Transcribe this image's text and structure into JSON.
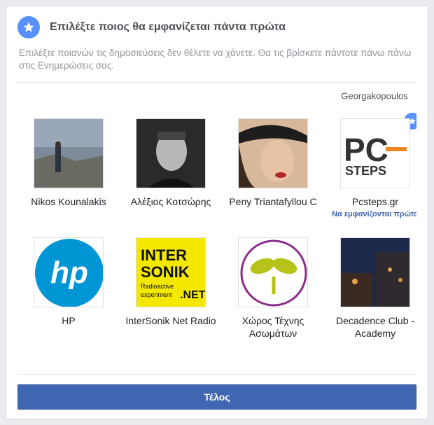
{
  "dialog": {
    "title": "Επιλέξτε ποιος θα εμφανίζεται πάντα πρώτα",
    "subtitle": "Επιλέξτε ποιανών τις δημοσιεύσεις δεν θέλετε να χάνετε. Θα τις βρίσκετε πάντοτε πάνω πάνω στις Ενημερώσεις σας.",
    "cut_off_name": "Georgakopoulos",
    "done_label": "Τέλος"
  },
  "people": [
    {
      "name": "Nikos Kounalakis",
      "icon": "photo-person-seaside"
    },
    {
      "name": "Αλέξιος Κοτσώρης",
      "icon": "photo-man-portrait"
    },
    {
      "name": "Peny Triantafyllou C",
      "icon": "photo-woman-hat"
    },
    {
      "name": "Pcsteps.gr",
      "icon": "pcsteps-logo",
      "pinned_note": "Να εμφανίζονται πρώτα"
    },
    {
      "name": "HP",
      "icon": "hp-logo"
    },
    {
      "name": "InterSonik Net Radio",
      "icon": "intersonik-logo"
    },
    {
      "name": "Χώρος Τέχνης Ασωμάτων",
      "icon": "sprout-logo"
    },
    {
      "name": "Decadence Club - Academy",
      "icon": "photo-building-night"
    }
  ],
  "colors": {
    "accent": "#5890ff",
    "button": "#4267b2",
    "hp_blue": "#0096d6",
    "intersonik_yellow": "#f5e800",
    "sprout_purple": "#8a2d8a",
    "sprout_green": "#b5c31a"
  }
}
